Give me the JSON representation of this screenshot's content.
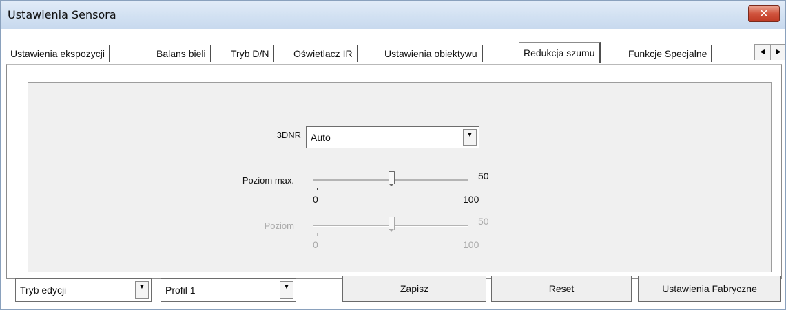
{
  "window": {
    "title": "Ustawienia Sensora",
    "close_label": "✕"
  },
  "tabs": [
    {
      "label": "Ustawienia ekspozycji",
      "active": false
    },
    {
      "label": "Balans bieli",
      "active": false
    },
    {
      "label": "Tryb D/N",
      "active": false
    },
    {
      "label": "Oświetlacz IR",
      "active": false
    },
    {
      "label": "Ustawienia obiektywu",
      "active": false
    },
    {
      "label": "Redukcja szumu",
      "active": true
    },
    {
      "label": "Funkcje Specjalne",
      "active": false
    }
  ],
  "tab_scroll": {
    "left_glyph": "◀",
    "right_glyph": "▶"
  },
  "panel": {
    "dnr": {
      "label": "3DNR",
      "value": "Auto",
      "arrow": "▼"
    },
    "max_level": {
      "label": "Poziom max.",
      "value": 50,
      "min_label": "0",
      "max_label": "100",
      "value_label": "50",
      "fraction": 0.5
    },
    "level": {
      "label": "Poziom",
      "value": 50,
      "min_label": "0",
      "max_label": "100",
      "value_label": "50",
      "fraction": 0.5,
      "disabled": true
    }
  },
  "bottom": {
    "mode": {
      "value": "Tryb edycji",
      "arrow": "▼"
    },
    "profile": {
      "value": "Profil 1",
      "arrow": "▼"
    },
    "save_label": "Zapisz",
    "reset_label": "Reset",
    "factory_label": "Ustawienia Fabryczne"
  }
}
